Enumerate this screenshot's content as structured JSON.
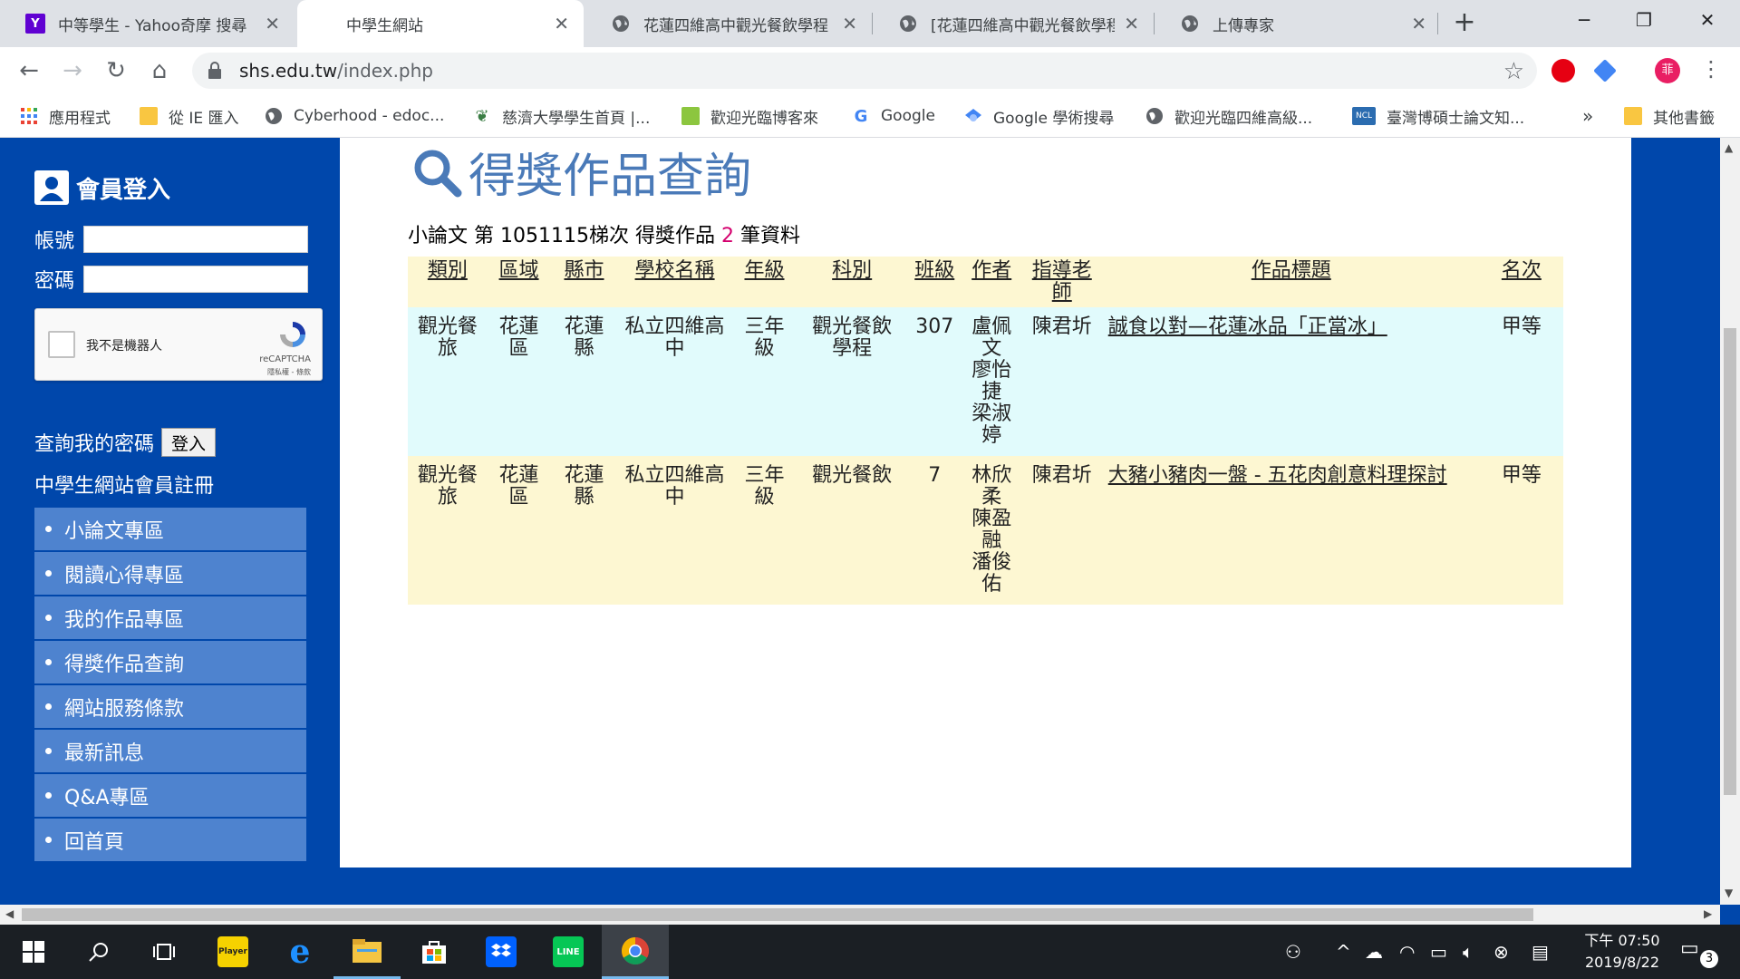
{
  "browser": {
    "tabs": [
      {
        "title": "中等學生 - Yahoo奇摩 搜尋",
        "icon": "yahoo-icon",
        "active": false
      },
      {
        "title": "中學生網站",
        "icon": "none",
        "active": true
      },
      {
        "title": "花蓮四維高中觀光餐飲學程",
        "icon": "globe-icon",
        "active": false
      },
      {
        "title": "[花蓮四維高中觀光餐飲學程",
        "icon": "globe-icon",
        "active": false
      },
      {
        "title": "上傳專家",
        "icon": "globe-icon",
        "active": false
      }
    ],
    "url_host": "shs.edu.tw",
    "url_path": "/index.php",
    "profile_initial": "菲",
    "bookmarks": [
      {
        "label": "應用程式",
        "icon": "apps-grid-icon"
      },
      {
        "label": "從 IE 匯入",
        "icon": "folder-icon"
      },
      {
        "label": "Cyberhood - edoc...",
        "icon": "globe-icon"
      },
      {
        "label": "慈濟大學學生首頁 |...",
        "icon": "site-icon"
      },
      {
        "label": "歡迎光臨博客來",
        "icon": "books-icon"
      },
      {
        "label": "Google",
        "icon": "google-icon"
      },
      {
        "label": "Google 學術搜尋",
        "icon": "scholar-icon"
      },
      {
        "label": "歡迎光臨四維高級...",
        "icon": "globe-icon"
      },
      {
        "label": "臺灣博碩士論文知...",
        "icon": "ncl-icon"
      }
    ],
    "bookmarks_more": "»",
    "other_bookmarks": "其他書籤"
  },
  "sidebar": {
    "login_title": "會員登入",
    "account_label": "帳號",
    "password_label": "密碼",
    "captcha_label": "我不是機器人",
    "captcha_brand": "reCAPTCHA",
    "captcha_terms": "隱私權 - 條款",
    "query_password": "查詢我的密碼",
    "login_button": "登入",
    "register": "中學生網站會員註冊",
    "menu": [
      "小論文專區",
      "閱讀心得專區",
      "我的作品專區",
      "得獎作品查詢",
      "網站服務條款",
      "最新訊息",
      "Q&A專區",
      "回首頁"
    ]
  },
  "content": {
    "heading": "得獎作品查詢",
    "summary_prefix": "小論文 第 ",
    "summary_period": "1051115",
    "summary_mid": "梯次 得獎作品 ",
    "summary_count": "2",
    "summary_suffix": " 筆資料",
    "columns": [
      "類別",
      "區域",
      "縣市",
      "學校名稱",
      "年級",
      "科別",
      "班級",
      "作者",
      "指導老師",
      "作品標題",
      "名次"
    ],
    "rows": [
      {
        "category": "觀光餐旅",
        "region": "花蓮區",
        "county": "花蓮縣",
        "school": "私立四維高中",
        "grade": "三年級",
        "dept": "觀光餐飲學程",
        "class": "307",
        "authors": "盧佩文\n廖怡捷\n梁淑婷",
        "teacher": "陳君圻",
        "title": "誠食以對—花蓮冰品「正當冰」",
        "rank": "甲等"
      },
      {
        "category": "觀光餐旅",
        "region": "花蓮區",
        "county": "花蓮縣",
        "school": "私立四維高中",
        "grade": "三年級",
        "dept": "觀光餐飲",
        "class": "7",
        "authors": "林欣柔\n陳盈融\n潘俊佑",
        "teacher": "陳君圻",
        "title": "大豬小豬肉一盤 - 五花肉創意料理探討",
        "rank": "甲等"
      }
    ]
  },
  "taskbar": {
    "time": "下午 07:50",
    "date": "2019/8/22",
    "notifications": "3",
    "apps": [
      "start-icon",
      "search-icon",
      "task-view-icon",
      "potplayer-icon",
      "edge-icon",
      "file-explorer-icon",
      "store-icon",
      "dropbox-icon",
      "line-icon",
      "chrome-icon"
    ],
    "potplayer_text": "Player",
    "line_text": "LINE"
  }
}
